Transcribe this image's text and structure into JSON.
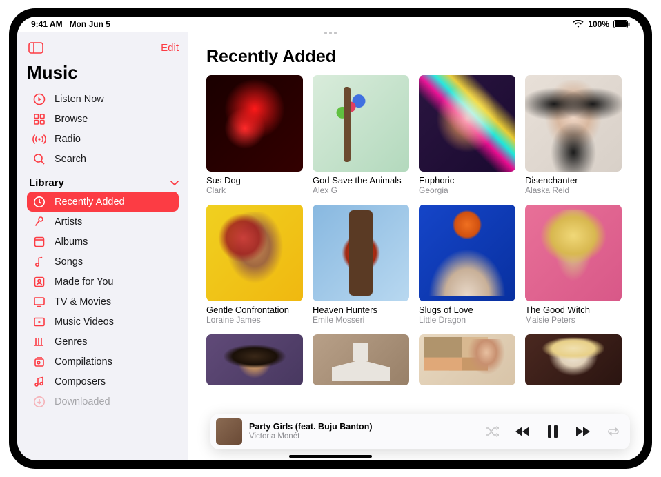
{
  "status": {
    "time": "9:41 AM",
    "date": "Mon Jun 5",
    "battery": "100%"
  },
  "sidebar": {
    "edit": "Edit",
    "title": "Music",
    "nav": [
      {
        "label": "Listen Now"
      },
      {
        "label": "Browse"
      },
      {
        "label": "Radio"
      },
      {
        "label": "Search"
      }
    ],
    "library_header": "Library",
    "library": [
      {
        "label": "Recently Added",
        "selected": true
      },
      {
        "label": "Artists"
      },
      {
        "label": "Albums"
      },
      {
        "label": "Songs"
      },
      {
        "label": "Made for You"
      },
      {
        "label": "TV & Movies"
      },
      {
        "label": "Music Videos"
      },
      {
        "label": "Genres"
      },
      {
        "label": "Compilations"
      },
      {
        "label": "Composers"
      },
      {
        "label": "Downloaded"
      }
    ]
  },
  "main": {
    "title": "Recently Added",
    "albums": [
      {
        "title": "Sus Dog",
        "artist": "Clark"
      },
      {
        "title": "God Save the Animals",
        "artist": "Alex G"
      },
      {
        "title": "Euphoric",
        "artist": "Georgia"
      },
      {
        "title": "Disenchanter",
        "artist": "Alaska Reid"
      },
      {
        "title": "Gentle Confrontation",
        "artist": "Loraine James"
      },
      {
        "title": "Heaven Hunters",
        "artist": "Emile Mosseri"
      },
      {
        "title": "Slugs of Love",
        "artist": "Little Dragon"
      },
      {
        "title": "The Good Witch",
        "artist": "Maisie Peters"
      },
      {
        "title": "",
        "artist": ""
      },
      {
        "title": "",
        "artist": ""
      },
      {
        "title": "",
        "artist": ""
      },
      {
        "title": "",
        "artist": ""
      }
    ]
  },
  "now_playing": {
    "title": "Party Girls (feat. Buju Banton)",
    "artist": "Victoria Monét"
  }
}
